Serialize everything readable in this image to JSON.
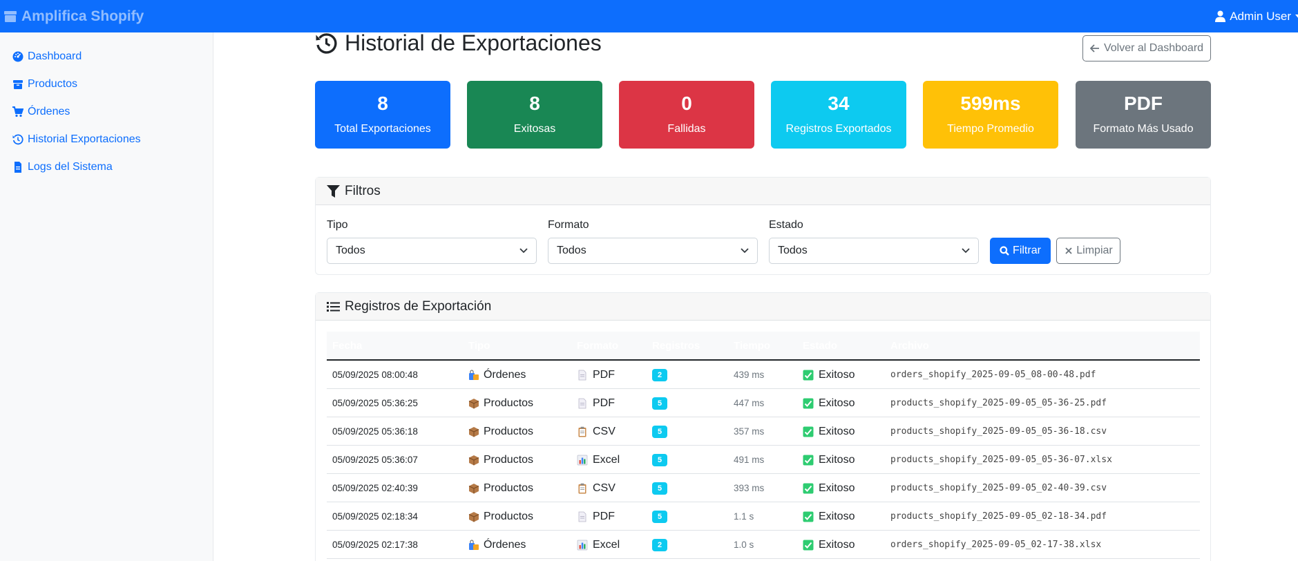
{
  "navbar": {
    "brand": "Amplifica Shopify",
    "user": "Admin User"
  },
  "sidebar": {
    "items": [
      {
        "label": "Dashboard",
        "icon": "dashboard-icon"
      },
      {
        "label": "Productos",
        "icon": "box-icon"
      },
      {
        "label": "Órdenes",
        "icon": "cart-icon"
      },
      {
        "label": "Historial Exportaciones",
        "icon": "history-icon"
      },
      {
        "label": "Logs del Sistema",
        "icon": "file-icon"
      }
    ]
  },
  "header": {
    "title": "Historial de Exportaciones",
    "back_label": "Volver al Dashboard"
  },
  "stats": [
    {
      "value": "8",
      "label": "Total Exportaciones",
      "color": "#0d6efd"
    },
    {
      "value": "8",
      "label": "Exitosas",
      "color": "#198754"
    },
    {
      "value": "0",
      "label": "Fallidas",
      "color": "#dc3545"
    },
    {
      "value": "34",
      "label": "Registros Exportados",
      "color": "#0dcaf0"
    },
    {
      "value": "599ms",
      "label": "Tiempo Promedio",
      "color": "#ffc107"
    },
    {
      "value": "PDF",
      "label": "Formato Más Usado",
      "color": "#6c757d"
    }
  ],
  "filters": {
    "title": "Filtros",
    "tipo_label": "Tipo",
    "tipo_value": "Todos",
    "formato_label": "Formato",
    "formato_value": "Todos",
    "estado_label": "Estado",
    "estado_value": "Todos",
    "filter_button": "Filtrar",
    "clear_button": "Limpiar"
  },
  "records": {
    "title": "Registros de Exportación",
    "columns": [
      "Fecha",
      "Tipo",
      "Formato",
      "Registros",
      "Tiempo",
      "Estado",
      "Archivo"
    ],
    "rows": [
      {
        "fecha": "05/09/2025 08:00:48",
        "tipo": "Órdenes",
        "formato": "PDF",
        "registros": "2",
        "tiempo": "439 ms",
        "estado": "Exitoso",
        "archivo": "orders_shopify_2025-09-05_08-00-48.pdf"
      },
      {
        "fecha": "05/09/2025 05:36:25",
        "tipo": "Productos",
        "formato": "PDF",
        "registros": "5",
        "tiempo": "447 ms",
        "estado": "Exitoso",
        "archivo": "products_shopify_2025-09-05_05-36-25.pdf"
      },
      {
        "fecha": "05/09/2025 05:36:18",
        "tipo": "Productos",
        "formato": "CSV",
        "registros": "5",
        "tiempo": "357 ms",
        "estado": "Exitoso",
        "archivo": "products_shopify_2025-09-05_05-36-18.csv"
      },
      {
        "fecha": "05/09/2025 05:36:07",
        "tipo": "Productos",
        "formato": "Excel",
        "registros": "5",
        "tiempo": "491 ms",
        "estado": "Exitoso",
        "archivo": "products_shopify_2025-09-05_05-36-07.xlsx"
      },
      {
        "fecha": "05/09/2025 02:40:39",
        "tipo": "Productos",
        "formato": "CSV",
        "registros": "5",
        "tiempo": "393 ms",
        "estado": "Exitoso",
        "archivo": "products_shopify_2025-09-05_02-40-39.csv"
      },
      {
        "fecha": "05/09/2025 02:18:34",
        "tipo": "Productos",
        "formato": "PDF",
        "registros": "5",
        "tiempo": "1.1 s",
        "estado": "Exitoso",
        "archivo": "products_shopify_2025-09-05_02-18-34.pdf"
      },
      {
        "fecha": "05/09/2025 02:17:38",
        "tipo": "Órdenes",
        "formato": "Excel",
        "registros": "2",
        "tiempo": "1.0 s",
        "estado": "Exitoso",
        "archivo": "orders_shopify_2025-09-05_02-17-38.xlsx"
      }
    ]
  }
}
